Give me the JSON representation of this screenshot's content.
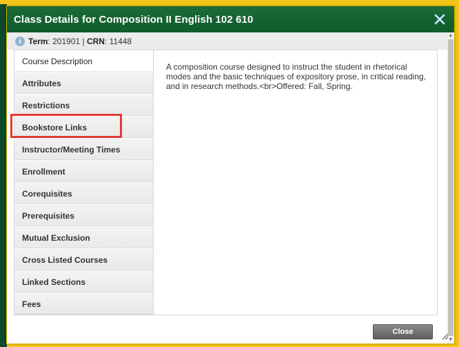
{
  "dialog": {
    "title": "Class Details for Composition II English 102 610",
    "close_icon": "close-x-icon"
  },
  "term_bar": {
    "icon": "info-icon",
    "term_label": "Term",
    "term_value": ": 201901 | ",
    "crn_label": "CRN",
    "crn_value": ": 11448"
  },
  "tabs": [
    {
      "label": "Course Description",
      "active": true
    },
    {
      "label": "Attributes"
    },
    {
      "label": "Restrictions"
    },
    {
      "label": "Bookstore Links",
      "highlighted": true
    },
    {
      "label": "Instructor/Meeting Times"
    },
    {
      "label": "Enrollment"
    },
    {
      "label": "Corequisites"
    },
    {
      "label": "Prerequisites"
    },
    {
      "label": "Mutual Exclusion"
    },
    {
      "label": "Cross Listed Courses"
    },
    {
      "label": "Linked Sections"
    },
    {
      "label": "Fees"
    }
  ],
  "description": "A composition course designed to instruct the student in rhetorical modes and the basic techniques of expository prose, in critical reading, and in research methods.<br>Offered: Fall, Spring.",
  "footer": {
    "close_label": "Close"
  },
  "colors": {
    "title_bar": "#0f5b2a",
    "page_background": "#f5c518",
    "highlight": "#e53935"
  }
}
